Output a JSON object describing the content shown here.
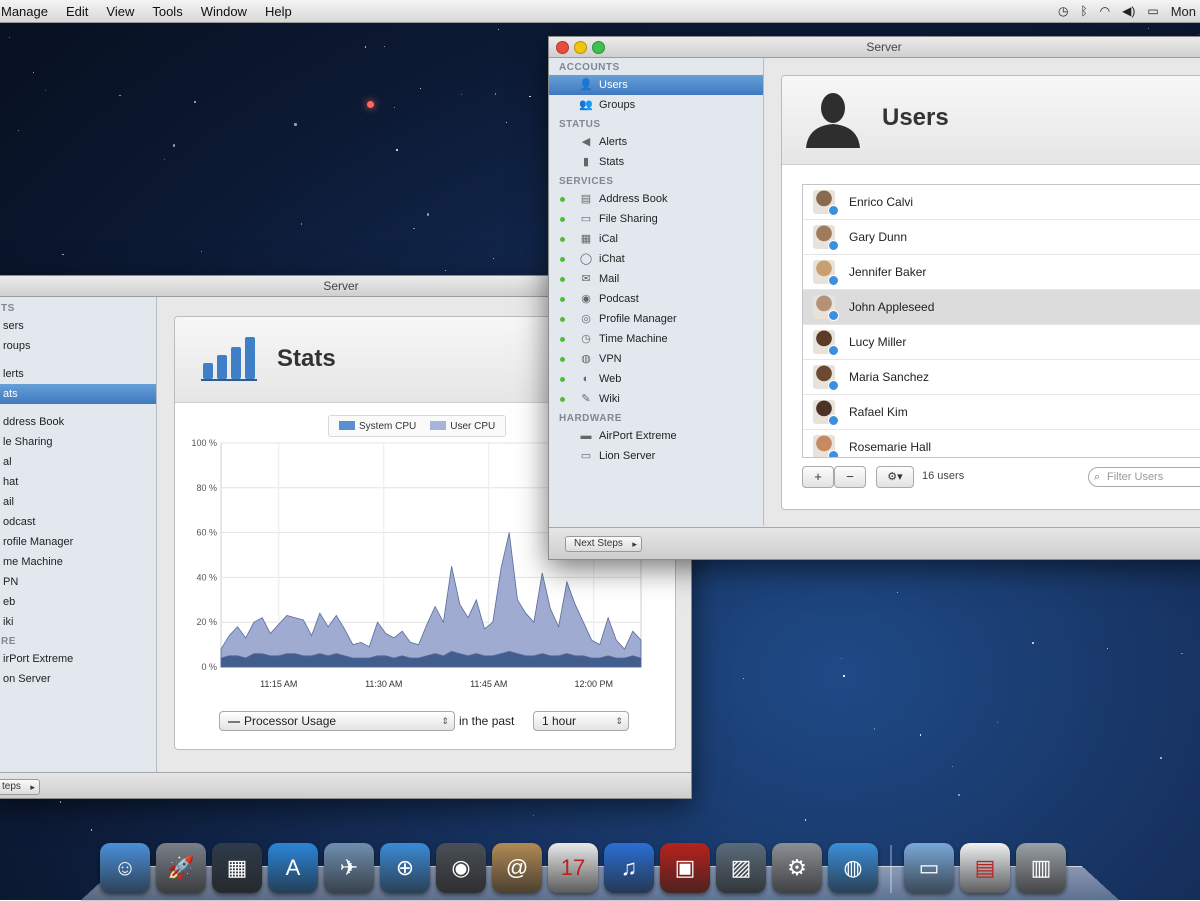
{
  "menubar": {
    "items": [
      "Manage",
      "Edit",
      "View",
      "Tools",
      "Window",
      "Help"
    ],
    "right_label": "Mon"
  },
  "stats_window": {
    "title": "Server",
    "sidebar": [
      {
        "type": "head",
        "label": "TS"
      },
      {
        "type": "item",
        "label": "sers"
      },
      {
        "type": "item",
        "label": "roups"
      },
      {
        "type": "gap"
      },
      {
        "type": "item",
        "label": "lerts"
      },
      {
        "type": "item",
        "label": "ats",
        "selected": true
      },
      {
        "type": "gap"
      },
      {
        "type": "item",
        "label": "ddress Book"
      },
      {
        "type": "item",
        "label": "le Sharing"
      },
      {
        "type": "item",
        "label": "al"
      },
      {
        "type": "item",
        "label": "hat"
      },
      {
        "type": "item",
        "label": "ail"
      },
      {
        "type": "item",
        "label": "odcast"
      },
      {
        "type": "item",
        "label": "rofile Manager"
      },
      {
        "type": "item",
        "label": "me Machine"
      },
      {
        "type": "item",
        "label": "PN"
      },
      {
        "type": "item",
        "label": "eb"
      },
      {
        "type": "item",
        "label": "iki"
      },
      {
        "type": "head",
        "label": "RE"
      },
      {
        "type": "item",
        "label": "irPort Extreme"
      },
      {
        "type": "item",
        "label": "on Server"
      }
    ],
    "panel_title": "Stats",
    "legend": [
      "System CPU",
      "User CPU"
    ],
    "metric_select": "Processor Usage",
    "in_the_past": "in the past",
    "range_select": "1 hour",
    "next_steps": "teps"
  },
  "chart_data": {
    "type": "area",
    "ylabel": "",
    "xlabel": "",
    "ylim": [
      0,
      100
    ],
    "y_ticks": [
      "0 %",
      "20 %",
      "40 %",
      "60 %",
      "80 %",
      "100 %"
    ],
    "x_ticks": [
      "11:15 AM",
      "11:30 AM",
      "11:45 AM",
      "12:00 PM"
    ],
    "series": [
      {
        "name": "User CPU",
        "color": "#9aa6cf",
        "values": [
          8,
          14,
          18,
          13,
          20,
          22,
          15,
          19,
          23,
          22,
          21,
          14,
          24,
          18,
          23,
          17,
          10,
          11,
          9,
          20,
          15,
          13,
          16,
          11,
          10,
          19,
          27,
          20,
          45,
          28,
          22,
          30,
          17,
          20,
          44,
          60,
          30,
          24,
          20,
          42,
          26,
          18,
          38,
          28,
          20,
          12,
          10,
          22,
          12,
          8,
          16,
          12
        ]
      },
      {
        "name": "System CPU",
        "color": "#3d5a8a",
        "values": [
          4,
          5,
          5,
          4,
          6,
          6,
          5,
          5,
          6,
          6,
          5,
          5,
          6,
          5,
          6,
          5,
          4,
          4,
          4,
          5,
          5,
          4,
          5,
          4,
          4,
          5,
          6,
          5,
          7,
          6,
          5,
          6,
          5,
          5,
          6,
          7,
          6,
          5,
          5,
          6,
          5,
          5,
          6,
          5,
          5,
          4,
          4,
          5,
          4,
          4,
          5,
          4
        ]
      }
    ]
  },
  "users_window": {
    "title": "Server",
    "sidebar": [
      {
        "type": "head",
        "label": "ACCOUNTS"
      },
      {
        "type": "item",
        "label": "Users",
        "icon": "user-icon",
        "selected": true
      },
      {
        "type": "item",
        "label": "Groups",
        "icon": "group-icon"
      },
      {
        "type": "head",
        "label": "STATUS"
      },
      {
        "type": "item",
        "label": "Alerts",
        "icon": "alerts-icon"
      },
      {
        "type": "item",
        "label": "Stats",
        "icon": "stats-icon"
      },
      {
        "type": "head",
        "label": "SERVICES"
      },
      {
        "type": "item",
        "label": "Address Book",
        "icon": "address-book-icon",
        "dot": true
      },
      {
        "type": "item",
        "label": "File Sharing",
        "icon": "folder-icon",
        "dot": true
      },
      {
        "type": "item",
        "label": "iCal",
        "icon": "calendar-icon",
        "dot": true
      },
      {
        "type": "item",
        "label": "iChat",
        "icon": "chat-icon",
        "dot": true
      },
      {
        "type": "item",
        "label": "Mail",
        "icon": "mail-icon",
        "dot": true
      },
      {
        "type": "item",
        "label": "Podcast",
        "icon": "podcast-icon",
        "dot": true
      },
      {
        "type": "item",
        "label": "Profile Manager",
        "icon": "profile-icon",
        "dot": true
      },
      {
        "type": "item",
        "label": "Time Machine",
        "icon": "time-machine-icon",
        "dot": true
      },
      {
        "type": "item",
        "label": "VPN",
        "icon": "vpn-icon",
        "dot": true
      },
      {
        "type": "item",
        "label": "Web",
        "icon": "web-icon",
        "dot": true
      },
      {
        "type": "item",
        "label": "Wiki",
        "icon": "wiki-icon",
        "dot": true
      },
      {
        "type": "head",
        "label": "HARDWARE"
      },
      {
        "type": "item",
        "label": "AirPort Extreme",
        "icon": "airport-icon"
      },
      {
        "type": "item",
        "label": "Lion Server",
        "icon": "server-icon"
      }
    ],
    "panel_title": "Users",
    "users": [
      {
        "name": "Enrico Calvi",
        "color": "#8a6a4e"
      },
      {
        "name": "Gary Dunn",
        "color": "#a07a5c"
      },
      {
        "name": "Jennifer Baker",
        "color": "#c9a06f"
      },
      {
        "name": "John Appleseed",
        "color": "#b59178",
        "selected": true
      },
      {
        "name": "Lucy Miller",
        "color": "#5a3b28"
      },
      {
        "name": "Maria Sanchez",
        "color": "#6b4a33"
      },
      {
        "name": "Rafael Kim",
        "color": "#4a3426"
      },
      {
        "name": "Rosemarie Hall",
        "color": "#c48a62"
      }
    ],
    "add_button": "+",
    "remove_button": "−",
    "gear_button": "⚙▾",
    "user_count": "16 users",
    "filter_placeholder": "Filter Users",
    "next_steps": "Next Steps"
  },
  "dock": [
    {
      "name": "finder",
      "color": "#4a90d9"
    },
    {
      "name": "launchpad",
      "color": "#7a7f88"
    },
    {
      "name": "mission-control",
      "color": "#2f3b4a"
    },
    {
      "name": "app-store",
      "color": "#2a86d8"
    },
    {
      "name": "preview",
      "color": "#6f8fb0"
    },
    {
      "name": "safari",
      "color": "#3c8bd6"
    },
    {
      "name": "facetime",
      "color": "#4a4f56"
    },
    {
      "name": "address-book",
      "color": "#b28a55"
    },
    {
      "name": "ical",
      "color": "#e9e9e9"
    },
    {
      "name": "itunes",
      "color": "#2b6fd3"
    },
    {
      "name": "photo-booth",
      "color": "#b7221c"
    },
    {
      "name": "iphoto",
      "color": "#5b6b7a"
    },
    {
      "name": "system-preferences",
      "color": "#8c8f94"
    },
    {
      "name": "server",
      "color": "#3b8fd8"
    },
    {
      "name": "sep"
    },
    {
      "name": "applications-folder",
      "color": "#7aa8d8"
    },
    {
      "name": "document",
      "color": "#eef0f2"
    },
    {
      "name": "trash",
      "color": "#9aa0a6"
    }
  ]
}
